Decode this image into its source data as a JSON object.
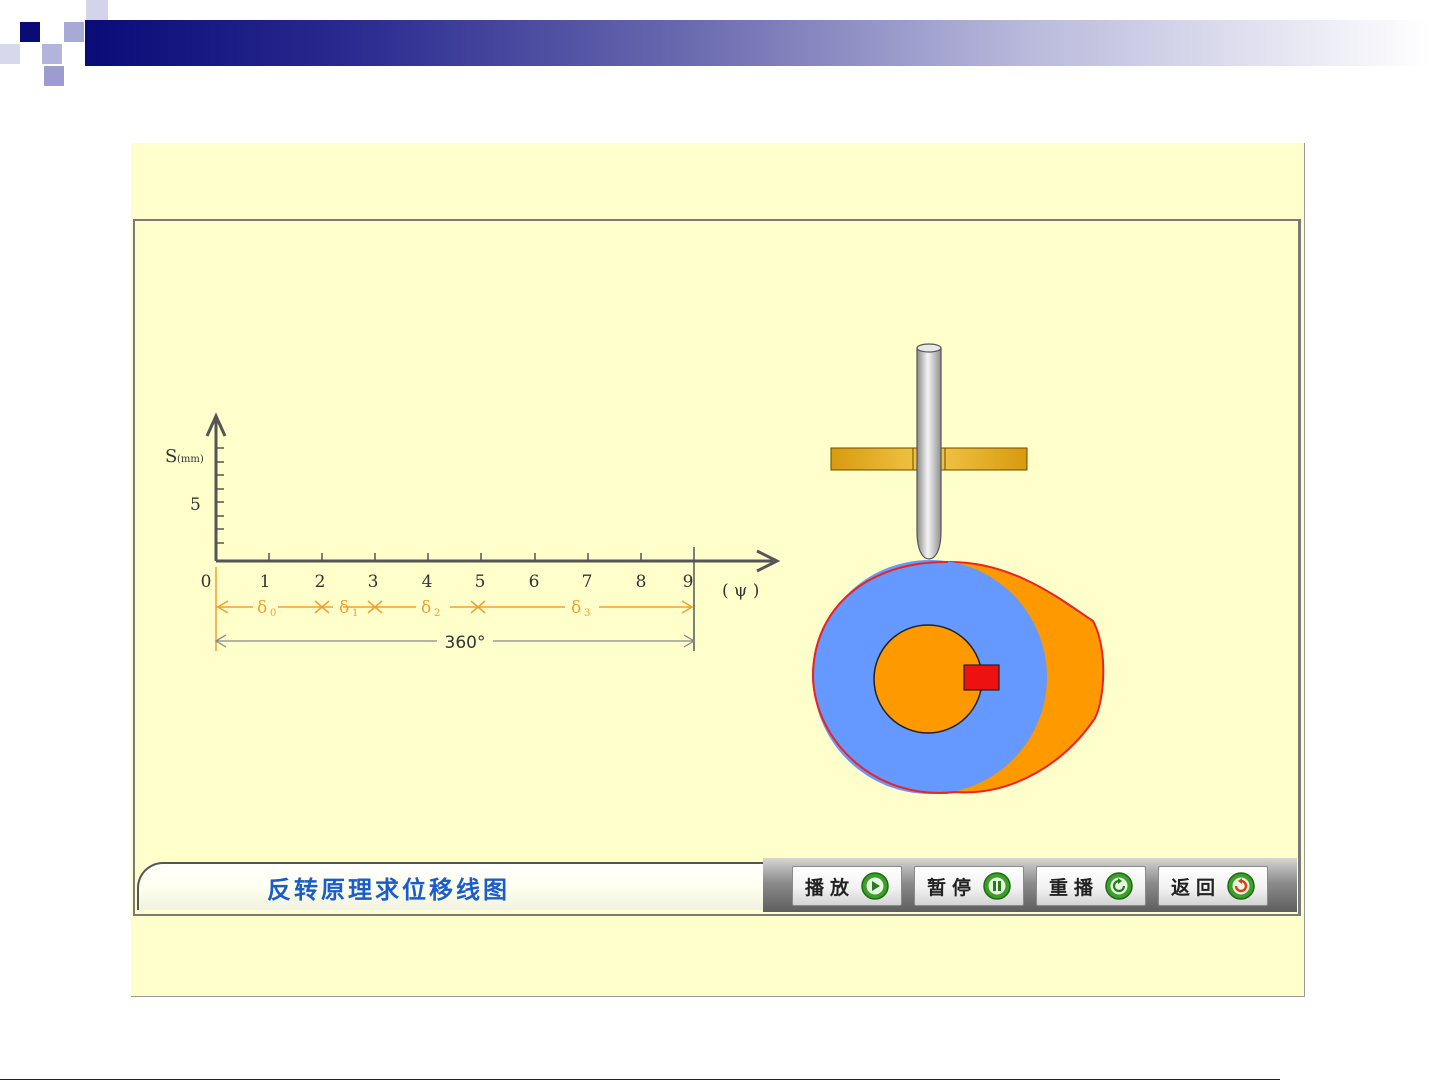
{
  "graph": {
    "y_axis_label": "S",
    "y_axis_unit": "(mm)",
    "y_tick_label": "5",
    "x_tick_labels": [
      "0",
      "1",
      "2",
      "3",
      "4",
      "5",
      "6",
      "7",
      "8",
      "9"
    ],
    "x_axis_label": "( ψ )",
    "phase_labels": [
      "δ",
      "δ",
      "δ",
      "δ"
    ],
    "phase_subscripts": [
      "0",
      "1",
      "2",
      "3"
    ],
    "full_cycle_label": "360°"
  },
  "title_panel": {
    "title": "反转原理求位移线图"
  },
  "controls": [
    {
      "label": "播放",
      "icon": "play-icon"
    },
    {
      "label": "暂停",
      "icon": "pause-icon"
    },
    {
      "label": "重播",
      "icon": "replay-icon"
    },
    {
      "label": "返回",
      "icon": "return-icon"
    }
  ],
  "colors": {
    "background": "#ffffcc",
    "cam_base_circle": "#6699ff",
    "cam_profile": "#ff9900",
    "cam_outline": "#ee2222",
    "hub": "#ff9900",
    "key": "#ee1111",
    "guide_bar": "#e8b020",
    "follower": "#b8b8b8",
    "dimension_lines": "#f0a030",
    "title_text": "#1a5cc8",
    "button_icon": "#3aa028"
  }
}
